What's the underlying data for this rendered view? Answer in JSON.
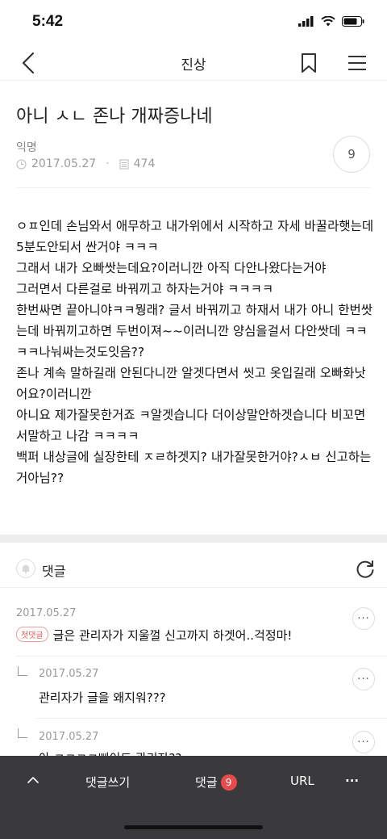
{
  "status": {
    "time": "5:42"
  },
  "nav": {
    "title": "진상"
  },
  "post": {
    "title": "아니 ㅅㄴ 존나 개짜증나네",
    "author": "익명",
    "date": "2017.05.27",
    "views": "474",
    "comment_count": "9",
    "body": "ㅇㅍ인데 손님와서 애무하고 내가위에서 시작하고 자세 바꿀라햇는데5분도안되서 싼거야 ㅋㅋㅋ\n그래서 내가 오빠쌋는데요?이러니깐 아직 다안나왔다는거야\n그러면서 다른걸로 바꿔끼고 하자는거야 ㅋㅋㅋㅋ\n한번싸면 끝아니야ㅋㅋ뭥래? 글서 바꿔끼고 하재서 내가 아니 한번쌋는데 바꿔끼고하면 두번이져~~이러니깐 양심을걸서 다안쌋데 ㅋㅋㅋㅋ나눠싸는것도잇음??\n존나 계속 말하길래 안된다니깐 알겟다면서 씻고 옷입길래 오빠화낫어요?이러니깐\n아니요 제가잘못한거죠 ㅋ알겟습니다 더이상말안하겟습니다 비꼬면서말하고 나감 ㅋㅋㅋㅋ\n백퍼 내상글에 실장한테 ㅈㄹ하겟지? 내가잘못한거야?ㅅㅂ 신고하는거아님??"
  },
  "comments_section": {
    "label": "댓글",
    "items": [
      {
        "date": "2017.05.27",
        "badge": "첫댓글",
        "text": "글은 관리자가 지울껄 신고까지 하겟어..걱정마!",
        "reply": false
      },
      {
        "date": "2017.05.27",
        "text": "관리자가 글을 왜지워???",
        "reply": true
      },
      {
        "date": "2017.05.27",
        "text": "아 ㅋㅋㅋㅋ삐이드 관리자??",
        "reply": true
      }
    ],
    "more_glyph": "···"
  },
  "bottom_bar": {
    "write_comment": "댓글쓰기",
    "comments": "댓글",
    "comments_badge": "9",
    "url": "URL",
    "more_glyph": "···"
  },
  "colors": {
    "accent_red": "#e84b4b",
    "bottom_bar": "#3a3a3d"
  }
}
